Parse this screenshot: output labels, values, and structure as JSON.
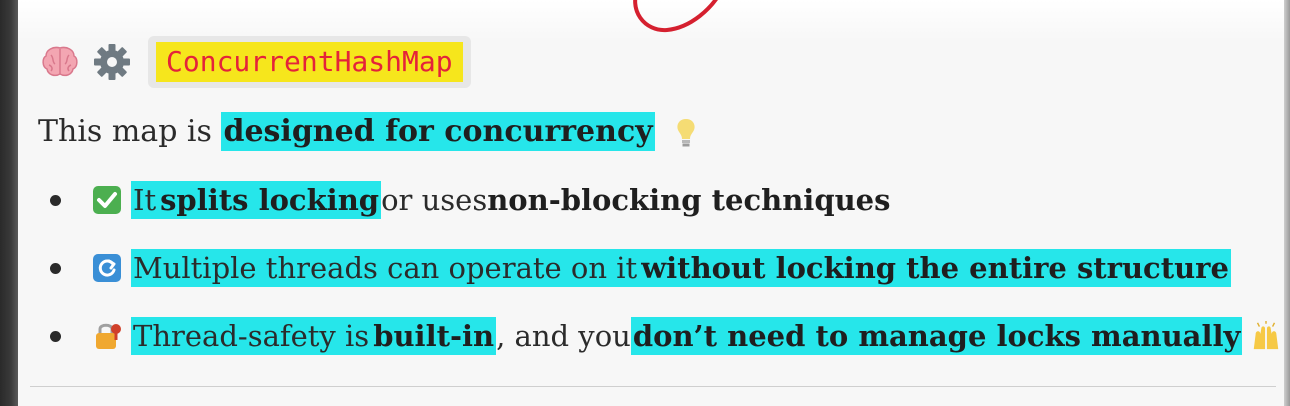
{
  "heading": {
    "icons": [
      "brain-icon",
      "gear-icon"
    ],
    "title": "ConcurrentHashMap"
  },
  "intro": {
    "prefix": "This map is ",
    "highlight": "designed for concurrency",
    "icon": "lightbulb-icon"
  },
  "bullets": [
    {
      "icon": "checkmark-icon",
      "parts": [
        "It ",
        "splits locking",
        " or uses ",
        "non-blocking techniques"
      ]
    },
    {
      "icon": "refresh-icon",
      "parts": [
        "Multiple threads can operate on it ",
        "without locking the entire structure"
      ]
    },
    {
      "icon": "lock-with-key-icon",
      "parts": [
        "Thread-safety is ",
        "built-in",
        ", and you ",
        "don’t need to manage locks manually"
      ],
      "trailing_icon": "raised-hands-icon"
    }
  ],
  "colors": {
    "highlight": "#26e6ea",
    "title_bg": "#f6e61c",
    "title_text": "#e4233a",
    "annotation_ink": "#d5202f"
  }
}
